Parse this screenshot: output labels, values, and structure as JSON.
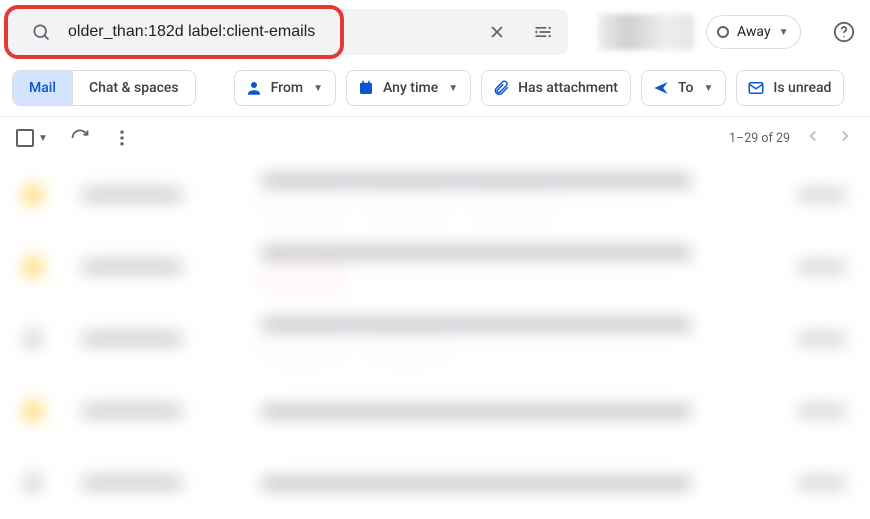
{
  "search": {
    "query": "older_than:182d label:client-emails"
  },
  "status": {
    "label": "Away"
  },
  "filters": {
    "segments": {
      "mail": "Mail",
      "chat": "Chat & spaces"
    },
    "from": "From",
    "anytime": "Any time",
    "has_attachment": "Has attachment",
    "to": "To",
    "is_unread": "Is unread"
  },
  "toolbar": {
    "count_text": "1–29 of 29"
  }
}
